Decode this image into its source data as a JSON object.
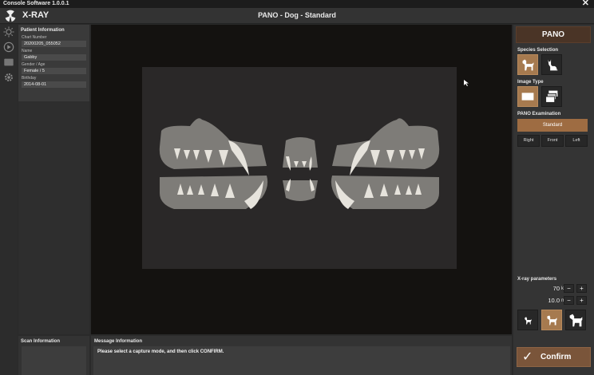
{
  "window": {
    "app_name": "Console Software  1.0.0.1",
    "close_glyph": "✕"
  },
  "header": {
    "brand": "X-RAY",
    "title": "PANO - Dog - Standard"
  },
  "patient": {
    "heading": "Patient Information",
    "fields": [
      {
        "label": "Chart Number",
        "value": "20200205_055052"
      },
      {
        "label": "Name",
        "value": "Gabby"
      },
      {
        "label": "Gender / Age",
        "value": "Female / 5"
      },
      {
        "label": "Birthday",
        "value": "2014-08-01"
      }
    ]
  },
  "scan_info": {
    "heading": "Scan Information"
  },
  "message": {
    "heading": "Message Information",
    "text": "Please select a capture mode, and then click CONFIRM."
  },
  "right_panel": {
    "mode": "PANO",
    "species_label": "Species Selection",
    "image_type_label": "Image Type",
    "pano_label": "PANO Examination",
    "standard": "Standard",
    "views": [
      "Right",
      "Front",
      "Left"
    ],
    "xray_label": "X-ray parameters",
    "params": [
      {
        "value": "70",
        "unit": "kVp"
      },
      {
        "value": "10.0",
        "unit": "mA"
      }
    ],
    "minus": "−",
    "plus": "+"
  },
  "confirm": {
    "label": "Confirm",
    "check": "✓"
  },
  "colors": {
    "accent": "#9e6c42",
    "selected_tile": "#a67a4f",
    "viewer_bg": "#141210"
  }
}
